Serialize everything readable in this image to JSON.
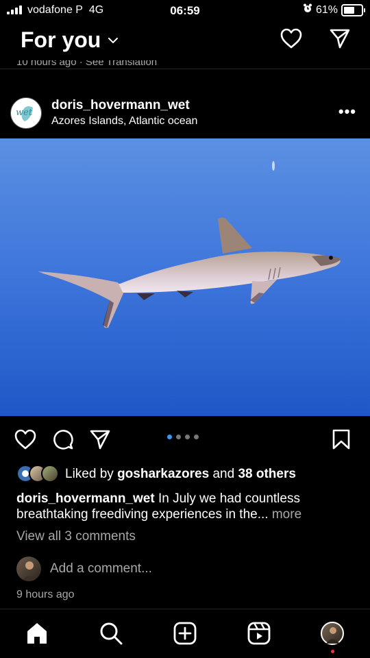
{
  "status_bar": {
    "carrier": "vodafone P",
    "network": "4G",
    "time": "06:59",
    "battery_percent": "61%",
    "battery_level": 0.61
  },
  "header": {
    "title": "For you",
    "cut_off_text": "10 hours ago · See Translation"
  },
  "post": {
    "username": "doris_hovermann_wet",
    "location": "Azores Islands, Atlantic ocean",
    "avatar_text": "wet",
    "carousel": {
      "count": 4,
      "active_index": 0
    },
    "likes": {
      "prefix": "Liked by",
      "user": "gosharkazores",
      "middle": "and",
      "others": "38 others"
    },
    "caption": {
      "username": "doris_hovermann_wet",
      "text": "In July we had countless breathtaking freediving experiences in the...",
      "more": "more"
    },
    "view_comments": "View all 3 comments",
    "add_comment_placeholder": "Add a comment...",
    "timestamp": "9 hours ago"
  },
  "icons": {
    "header": [
      "heart-icon",
      "send-icon"
    ],
    "actions": [
      "like-icon",
      "comment-icon",
      "share-icon",
      "bookmark-icon"
    ],
    "tabs": [
      "home-icon",
      "search-icon",
      "create-icon",
      "reels-icon",
      "profile-avatar"
    ]
  },
  "colors": {
    "background": "#000000",
    "muted_text": "#a8a8a8",
    "carousel_active": "#3897f0",
    "notification_dot": "#ff3040",
    "ocean_top": "#5b8ee0",
    "ocean_bottom": "#2058c8"
  }
}
